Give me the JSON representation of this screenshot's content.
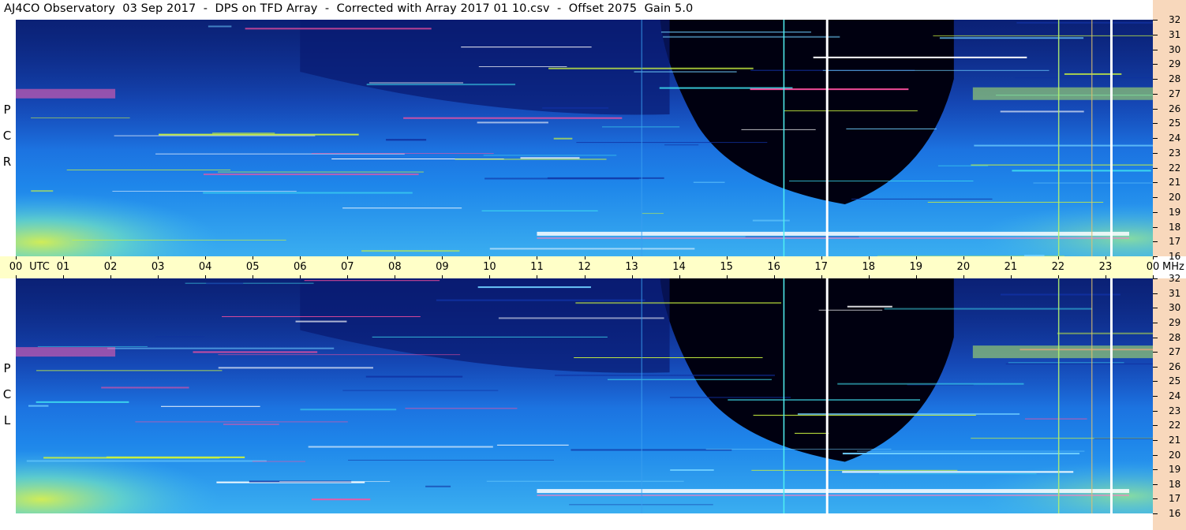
{
  "title": "AJ4CO Observatory  03 Sep 2017  -  DPS on TFD Array  -  Corrected with Array 2017 01 10.csv  -  Offset 2075  Gain 5.0",
  "polarizations": {
    "top": [
      "R",
      "C",
      "P"
    ],
    "bottom": [
      "L",
      "C",
      "P"
    ]
  },
  "time_axis": {
    "label": "UTC",
    "unit": "MHz",
    "ticks": [
      "00",
      "01",
      "02",
      "03",
      "04",
      "05",
      "06",
      "07",
      "08",
      "09",
      "10",
      "11",
      "12",
      "13",
      "14",
      "15",
      "16",
      "17",
      "18",
      "19",
      "20",
      "21",
      "22",
      "23",
      "00"
    ]
  },
  "freq_axis": {
    "ticks": [
      "16",
      "17",
      "18",
      "19",
      "20",
      "21",
      "22",
      "23",
      "24",
      "25",
      "26",
      "27",
      "28",
      "29",
      "30",
      "31",
      "32"
    ]
  },
  "colors": {
    "quiet": "#000000",
    "low": "#0a2a9a",
    "mid": "#1f7ae8",
    "high": "#5ad0f0",
    "very_high": "#c8f040",
    "max": "#ff40a0",
    "time_axis_bg": "#ffffc8",
    "freq_axis_bg": "#f8d8bc"
  },
  "chart_data": {
    "type": "heatmap",
    "title": "AJ4CO Observatory  03 Sep 2017  -  DPS on TFD Array  -  Corrected with Array 2017 01 10.csv  -  Offset 2075  Gain 5.0",
    "xlabel": "UTC",
    "ylabel": "MHz",
    "x_range_hours": [
      0,
      24
    ],
    "y_range_mhz": [
      16,
      32
    ],
    "panels": [
      "RCP",
      "LCP"
    ],
    "markers_hours": [
      17.1,
      23.1
    ]
  }
}
